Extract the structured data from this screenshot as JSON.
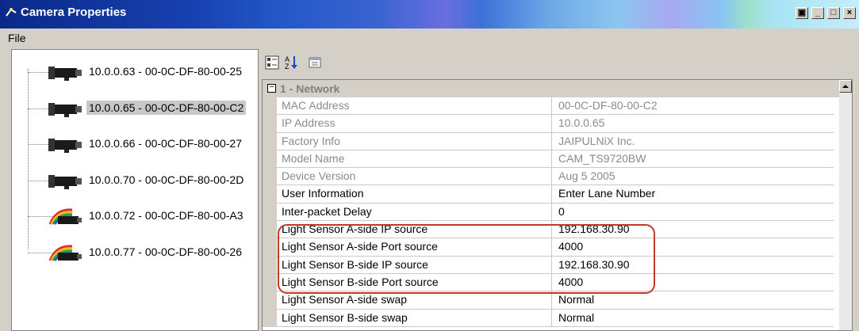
{
  "window": {
    "title": "Camera Properties"
  },
  "menu": {
    "file": "File"
  },
  "tree": [
    {
      "label": "10.0.0.63 - 00-0C-DF-80-00-25",
      "icon": "camera-icon"
    },
    {
      "label": "10.0.0.65 - 00-0C-DF-80-00-C2",
      "icon": "camera-icon",
      "selected": true
    },
    {
      "label": "10.0.0.66 - 00-0C-DF-80-00-27",
      "icon": "camera-icon"
    },
    {
      "label": "10.0.0.70 - 00-0C-DF-80-00-2D",
      "icon": "camera-icon"
    },
    {
      "label": "10.0.0.72 - 00-0C-DF-80-00-A3",
      "icon": "camera-rainbow-icon"
    },
    {
      "label": "10.0.0.77 - 00-0C-DF-80-00-26",
      "icon": "camera-rainbow-icon"
    }
  ],
  "toolbar": {
    "categorized": "categorized-icon",
    "alphabetical": "sort-az-icon",
    "property_pages": "property-pages-icon"
  },
  "grid": {
    "category": "1 - Network",
    "expander": "⊟",
    "rows": [
      {
        "name": "MAC Address",
        "value": "00-0C-DF-80-00-C2",
        "readonly": true
      },
      {
        "name": "IP Address",
        "value": "10.0.0.65",
        "readonly": true
      },
      {
        "name": "Factory Info",
        "value": "JAIPULNiX Inc.",
        "readonly": true
      },
      {
        "name": "Model Name",
        "value": "CAM_TS9720BW",
        "readonly": true
      },
      {
        "name": "Device Version",
        "value": "Aug 5 2005",
        "readonly": true
      },
      {
        "name": "User Information",
        "value": "Enter Lane Number",
        "readonly": false
      },
      {
        "name": "Inter-packet Delay",
        "value": "0",
        "readonly": false
      },
      {
        "name": "Light Sensor A-side IP source",
        "value": "192.168.30.90",
        "readonly": false
      },
      {
        "name": "Light Sensor A-side Port source",
        "value": "4000",
        "readonly": false
      },
      {
        "name": "Light Sensor B-side IP source",
        "value": "192.168.30.90",
        "readonly": false
      },
      {
        "name": "Light Sensor B-side Port source",
        "value": "4000",
        "readonly": false
      },
      {
        "name": "Light Sensor A-side swap",
        "value": "Normal",
        "readonly": false
      },
      {
        "name": "Light Sensor B-side swap",
        "value": "Normal",
        "readonly": false
      }
    ]
  },
  "colors": {
    "highlight": "#c0392b",
    "title_text": "#ffffff",
    "readonly_text": "#8a8a8a"
  }
}
